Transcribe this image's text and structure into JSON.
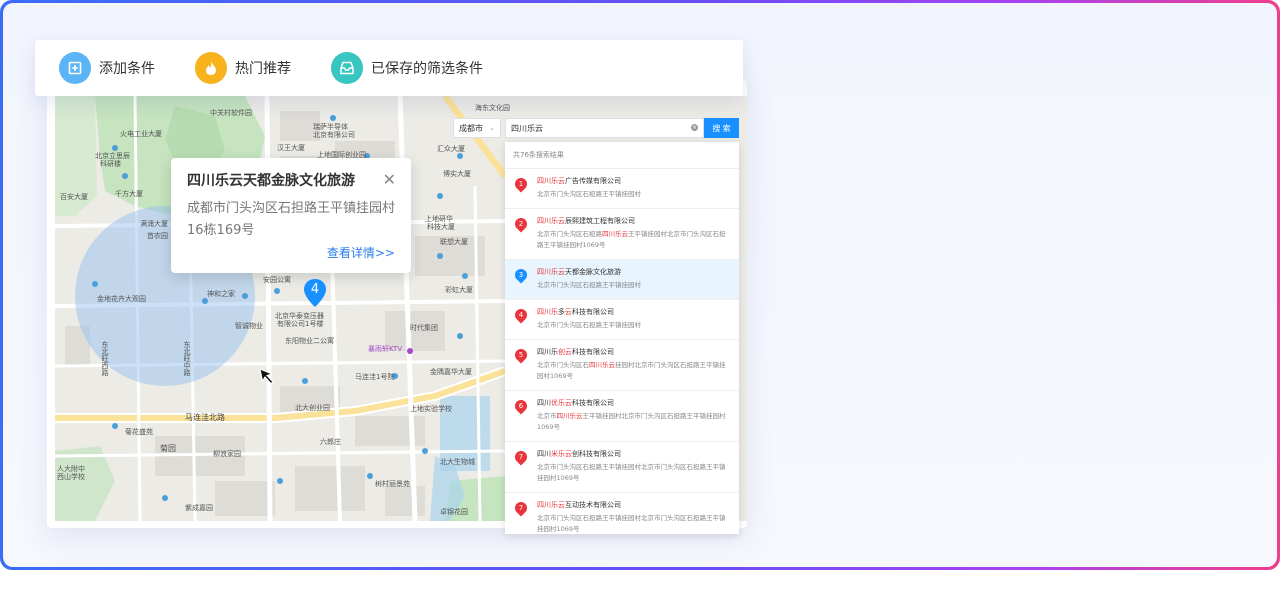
{
  "toolbar": {
    "items": [
      {
        "label": "添加条件",
        "icon": "add-condition-icon",
        "color": "#5ab4f5"
      },
      {
        "label": "热门推荐",
        "icon": "flame-icon",
        "color": "#f7b21c"
      },
      {
        "label": "已保存的筛选条件",
        "icon": "inbox-icon",
        "color": "#37c6c0"
      }
    ]
  },
  "popup": {
    "title": "四川乐云天都金脉文化旅游",
    "address": "成都市门头沟区石担路王平镇挂园村16栋169号",
    "link": "查看详情>>"
  },
  "marker": {
    "number": "4",
    "color": "#1890ff"
  },
  "search": {
    "city": "成都市",
    "query": "四川乐云",
    "button": "搜 索",
    "count_text": "共76条搜索结果"
  },
  "results": [
    {
      "num": "1",
      "pre": "",
      "hl": "四川乐云",
      "post": "广告传媒有限公司",
      "addr": "北京市门头沟区石担路王平镇挂园村",
      "active": false
    },
    {
      "num": "2",
      "pre": "",
      "hl": "四川乐云",
      "post": "辰熙建筑工程有限公司",
      "addr_pre": "北京市门头沟区石担路",
      "addr_hl": "四川乐云",
      "addr_post": "王平镇挂园村北京市门头沟区石担路王平镇挂园村1069号",
      "active": false
    },
    {
      "num": "3",
      "pre": "",
      "hl": "四川乐云",
      "post": "天都金脉文化旅游",
      "addr": "北京市门头沟区石担路王平镇挂园村",
      "active": true
    },
    {
      "num": "4",
      "pre": "",
      "hl": "四川乐",
      "post": "多云科技有限公司",
      "post_hl": "云",
      "addr": "北京市门头沟区石担路王平镇挂园村",
      "active": false
    },
    {
      "num": "5",
      "pre": "四川乐",
      "hl": "创云",
      "post": "科技有限公司",
      "addr_pre": "北京市门头沟区石",
      "addr_hl": "四川乐云",
      "addr_post": "挂园村北京市门头沟区石担路王平镇挂园村1069号",
      "active": false
    },
    {
      "num": "6",
      "pre": "四川",
      "hl": "优乐云",
      "post": "科技有限公司",
      "addr_pre": "北京市",
      "addr_hl": "四川乐云",
      "addr_post": "王平镇挂园村北京市门头沟区石担路王平镇挂园村1069号",
      "active": false
    },
    {
      "num": "7",
      "pre": "四川",
      "hl": "米乐云",
      "post": "创科技有限公司",
      "addr": "北京市门头沟区石担路王平镇挂园村北京市门头沟区石担路王平镇挂园村1069号",
      "active": false
    },
    {
      "num": "7",
      "pre": "",
      "hl": "四川乐云",
      "post": "互动技术有限公司",
      "addr": "北京市门头沟区石担路王平镇挂园村北京市门头沟区石担路王平镇挂园村1069号",
      "active": false
    }
  ],
  "map_labels": [
    "海淀公园",
    "中关村软件园",
    "瑞萨半导体",
    "北京有限公司",
    "汉王大厦",
    "上地国际创业园",
    "汇众大厦",
    "博实大厦",
    "上地研华",
    "科技大厦",
    "联想大厦",
    "彩虹大厦",
    "群英科技",
    "时代集团",
    "东阳物业二公寓",
    "暴雨轩KTV",
    "马连洼1号院",
    "金隅嘉华大厦",
    "北大创业园",
    "上地实验学校",
    "马连洼北路",
    "菊园",
    "六郎庄",
    "柳浪家园",
    "树村丽景苑",
    "金地花卉大观园",
    "神和之家",
    "智诚物业",
    "安园公寓",
    "北京华泰变压器",
    "有限公司1号楼",
    "紫成嘉园",
    "菊花盛苑",
    "人大附中西山学校",
    "北大生物城",
    "卓锦花园",
    "满涌大厦",
    "首农园",
    "百安大厦",
    "北京立思辰科研楼",
    "千方大厦",
    "海东文化园",
    "火电工业大厦"
  ]
}
